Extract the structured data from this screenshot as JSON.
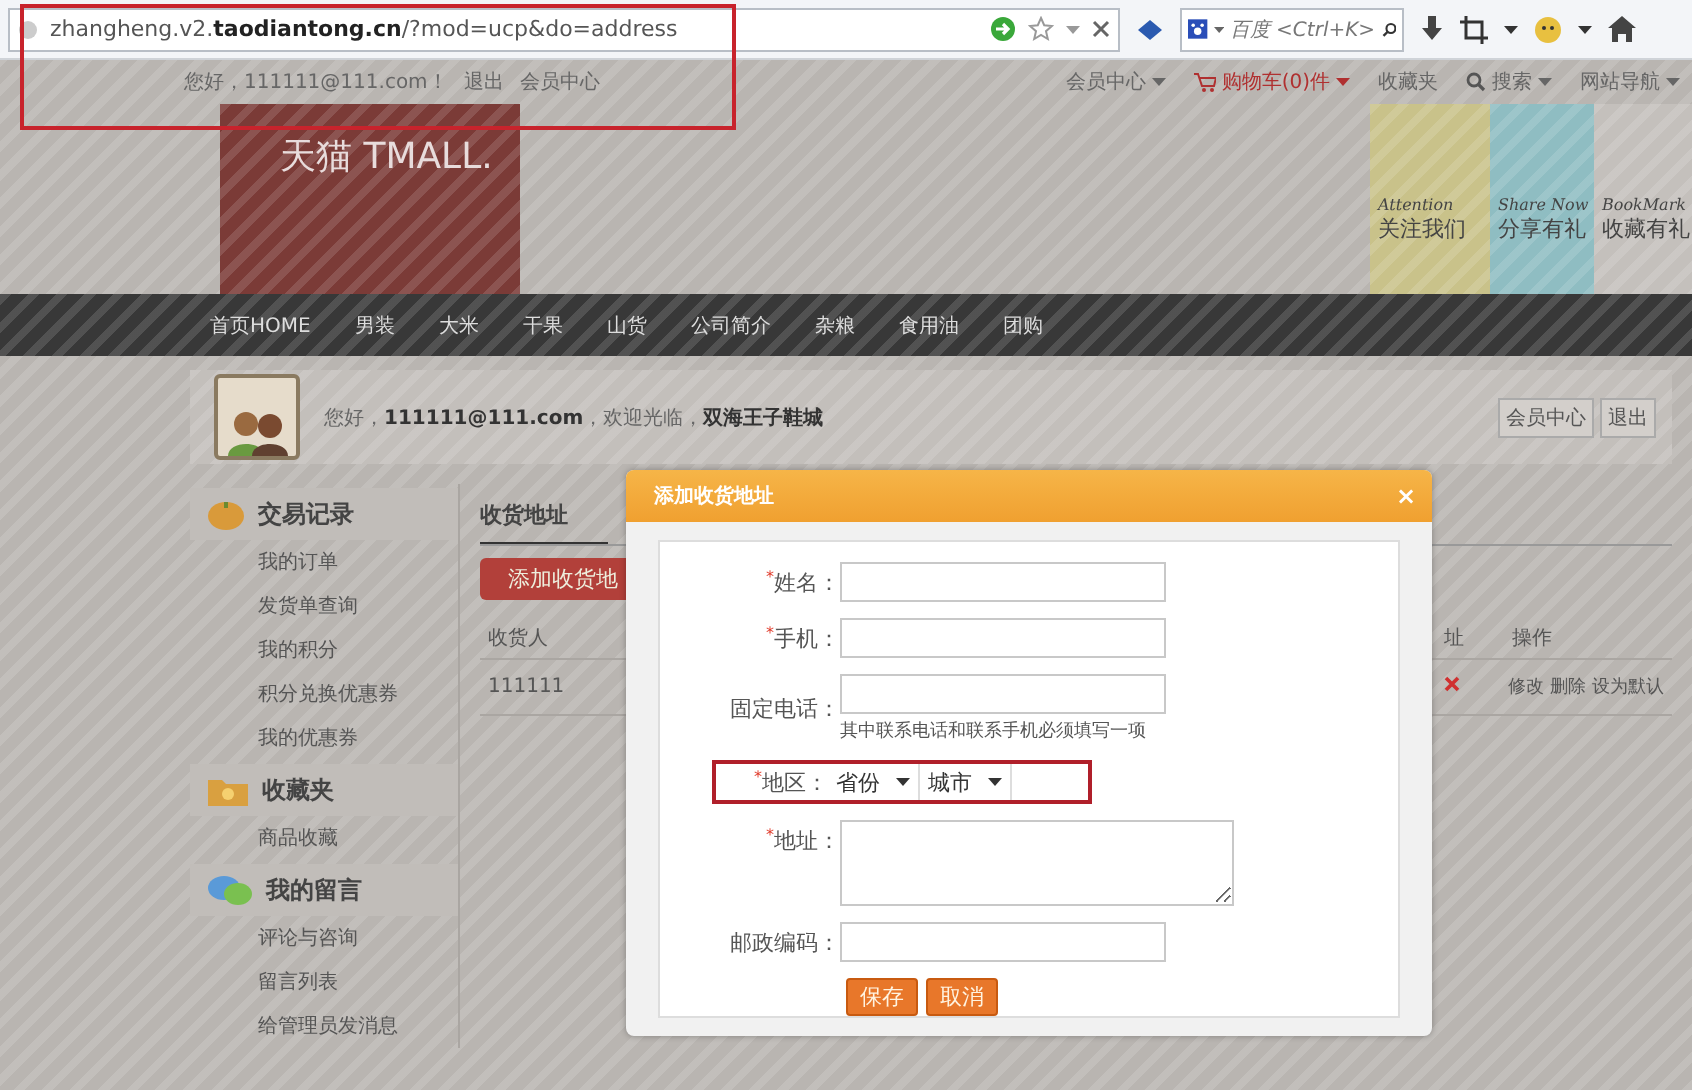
{
  "browser": {
    "url": "zhangheng.v2.**taodiantong.cn**/?mod=ucp&do=address",
    "url_highlighted": true,
    "search_placeholder": "百度 <Ctrl+K>"
  },
  "topbar": {
    "greeting": "您好，111111@111.com！",
    "links": [
      "退出",
      "会员中心"
    ],
    "menu": [
      {
        "kind": "link",
        "label": "会员中心",
        "dropdown": true
      },
      {
        "kind": "cart",
        "label": "购物车(0)件",
        "dropdown": true
      },
      {
        "kind": "link",
        "label": "收藏夹",
        "dropdown": false
      },
      {
        "kind": "search",
        "label": "搜索",
        "dropdown": true
      },
      {
        "kind": "link",
        "label": "网站导航",
        "dropdown": true
      }
    ]
  },
  "header": {
    "logo": "天猫 TMALL.",
    "tiles": [
      {
        "en": "Attention",
        "zh": "关注我们",
        "color": "#c9c28a"
      },
      {
        "en": "Share Now",
        "zh": "分享有礼",
        "color": "#8fbdc2"
      },
      {
        "en": "BookMark",
        "zh": "收藏有礼",
        "color": "#c4c0bc"
      }
    ]
  },
  "nav": [
    "首页HOME",
    "男装",
    "大米",
    "干果",
    "山货",
    "公司简介",
    "杂粮",
    "食用油",
    "团购"
  ],
  "user_panel": {
    "greeting": "您好，**111111@111.com**，欢迎光临，**双海王子鞋城**",
    "buttons": [
      "会员中心",
      "退出"
    ]
  },
  "sidebar": [
    {
      "kind": "trade",
      "title": "交易记录",
      "items": [
        "我的订单",
        "发货单查询",
        "我的积分",
        "积分兑换优惠券",
        "我的优惠券"
      ]
    },
    {
      "kind": "favorites",
      "title": "收藏夹",
      "items": [
        "商品收藏"
      ]
    },
    {
      "kind": "messages",
      "title": "我的留言",
      "items": [
        "评论与咨询",
        "留言列表",
        "给管理员发消息"
      ]
    }
  ],
  "content": {
    "tab": "收货地址",
    "add_button": "添加收货地",
    "columns": [
      "收货人",
      "址",
      "操作"
    ],
    "rows": [
      {
        "receiver": "111111",
        "actions": [
          "修改",
          "删除",
          "设为默认"
        ]
      }
    ]
  },
  "dialog": {
    "title": "添加收货地址",
    "close": "×",
    "fields": [
      {
        "kind": "text",
        "mark": "*",
        "label": "姓名："
      },
      {
        "kind": "text",
        "mark": "*",
        "label": "手机："
      },
      {
        "kind": "text",
        "label": "固定电话：",
        "hint": "其中联系电话和联系手机必须填写一项"
      },
      {
        "kind": "select",
        "mark": "*",
        "label": "地区：",
        "selects": [
          "省份",
          "城市"
        ],
        "highlighted": true
      },
      {
        "kind": "textarea",
        "mark": "*",
        "label": "地址："
      },
      {
        "kind": "text",
        "label": "邮政编码："
      }
    ],
    "buttons": [
      "保存",
      "取消"
    ]
  }
}
